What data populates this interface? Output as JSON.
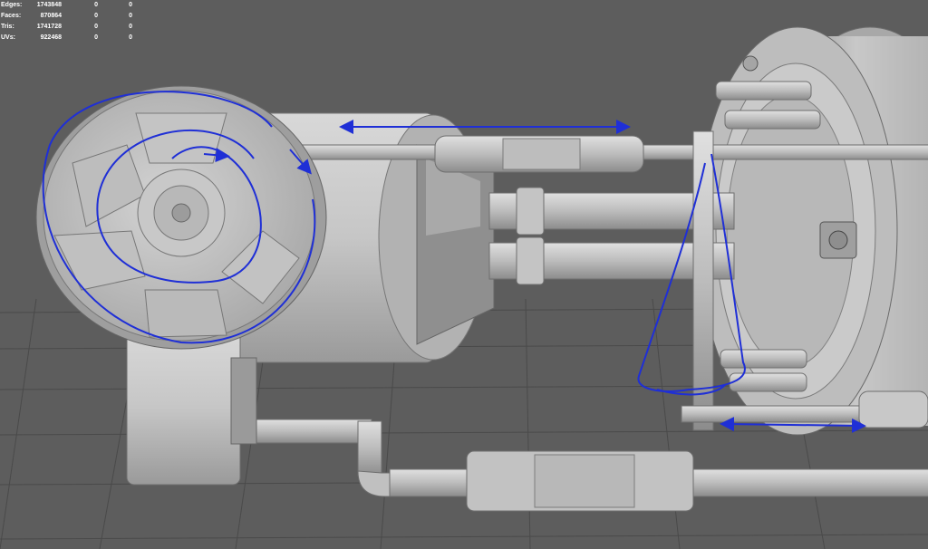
{
  "hud": {
    "rows": [
      {
        "label": "Edges:",
        "value": "1743848",
        "sel": "0",
        "comp": "0"
      },
      {
        "label": "Faces:",
        "value": "870864",
        "sel": "0",
        "comp": "0"
      },
      {
        "label": "Tris:",
        "value": "1741728",
        "sel": "0",
        "comp": "0"
      },
      {
        "label": "UVs:",
        "value": "922468",
        "sel": "0",
        "comp": "0"
      }
    ]
  },
  "colors": {
    "background": "#5d5d5d",
    "grid_line": "#4a4a4a",
    "model_light": "#cfcfcf",
    "model_mid": "#b4b4b4",
    "model_dark": "#8a8a8a",
    "annotation": "#1f2fd6",
    "hud_text": "#ffffff"
  }
}
